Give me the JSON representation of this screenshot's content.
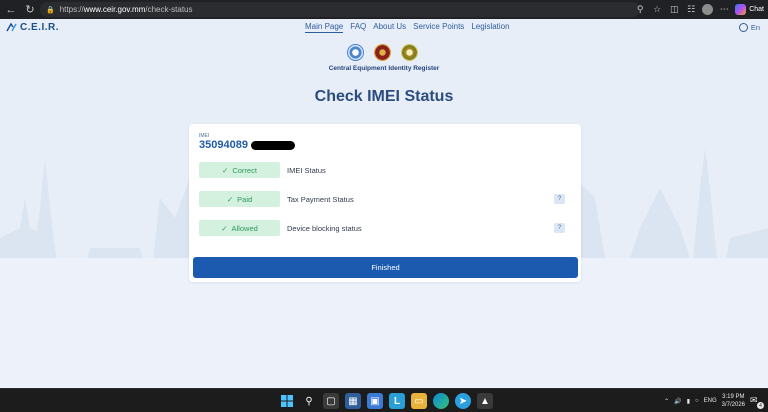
{
  "browser": {
    "url_prefix": "https://",
    "url_host": "www.ceir.gov.mm",
    "url_path": "/check-status",
    "copilot_label": "Chat",
    "icons": [
      "back-arrow-icon",
      "refresh-icon",
      "lock-icon",
      "zoom-icon",
      "star-icon",
      "extensions-icon",
      "collections-icon",
      "profile-icon",
      "more-icon"
    ]
  },
  "site": {
    "logo_text": "C.E.I.R.",
    "nav": [
      "Main Page",
      "FAQ",
      "About Us",
      "Service Points",
      "Legislation"
    ],
    "lang": "En",
    "subtitle": "Central Equipment Identity Register"
  },
  "main": {
    "title": "Check IMEI Status",
    "imei_label": "IMEI",
    "imei_value": "35094089",
    "rows": [
      {
        "status": "Correct",
        "label": "IMEI Status",
        "help": false
      },
      {
        "status": "Paid",
        "label": "Tax Payment Status",
        "help": true
      },
      {
        "status": "Allowed",
        "label": "Device blocking status",
        "help": true
      }
    ],
    "help_glyph": "?",
    "finish_label": "Finished"
  },
  "colors": {
    "accent": "#1c5ab0",
    "title": "#2a4d7e",
    "pill_bg": "#d4f0de",
    "pill_text": "#2e9a5a",
    "page_bg": "#e8eef8"
  },
  "taskbar": {
    "lang": "ENG",
    "time": "3:19 PM",
    "date": "3/7/2026",
    "notification_count": "4"
  }
}
